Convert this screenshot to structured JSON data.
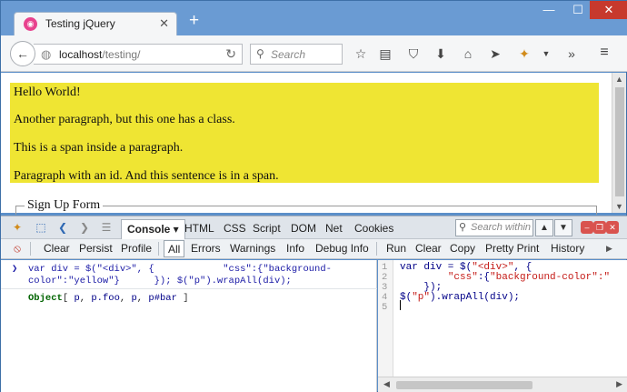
{
  "browser": {
    "tab_title": "Testing jQuery",
    "new_tab": "+",
    "url_host": "localhost",
    "url_path": "/testing/",
    "search_placeholder": "Search",
    "window_buttons": {
      "minimize": "—",
      "maximize": "☐",
      "close": "✕"
    }
  },
  "page": {
    "paragraphs": [
      "Hello World!",
      "Another paragraph, but this one has a class.",
      "This is a span inside a paragraph.",
      "Paragraph with an id. And this sentence is in a span."
    ],
    "highlight_color": "#efe533",
    "legend": "Sign Up Form"
  },
  "firebug": {
    "panels": [
      "Console",
      "HTML",
      "CSS",
      "Script",
      "DOM",
      "Net",
      "Cookies"
    ],
    "active_panel": "Console",
    "search_placeholder": "Search within C",
    "toolbar": [
      "Clear",
      "Persist",
      "Profile",
      "All",
      "Errors",
      "Warnings",
      "Info",
      "Debug Info"
    ],
    "editor_toolbar": [
      "Run",
      "Clear",
      "Copy",
      "Pretty Print",
      "History"
    ],
    "console_command": [
      "var div = $(\"<div>\", {            \"css\":{\"background-",
      "color\":\"yellow\"}      }); $(\"p\").wrapAll(div);"
    ],
    "console_result": {
      "label": "Object",
      "open": "[",
      "items": [
        "p",
        "p.foo",
        "p",
        "p#bar"
      ],
      "close": "]"
    },
    "editor_lines": [
      "1",
      "2",
      "3",
      "4",
      "5"
    ],
    "editor_code": {
      "l1_a": "var div = $(",
      "l1_s": "\"<div>\"",
      "l1_b": ", {",
      "l2_s1": "\"css\"",
      "l2_b": ":{",
      "l2_s2": "\"background-color\":\"",
      "l3": "    });",
      "l4_a": "$(",
      "l4_s": "\"p\"",
      "l4_b": ").wrapAll(div);"
    }
  }
}
